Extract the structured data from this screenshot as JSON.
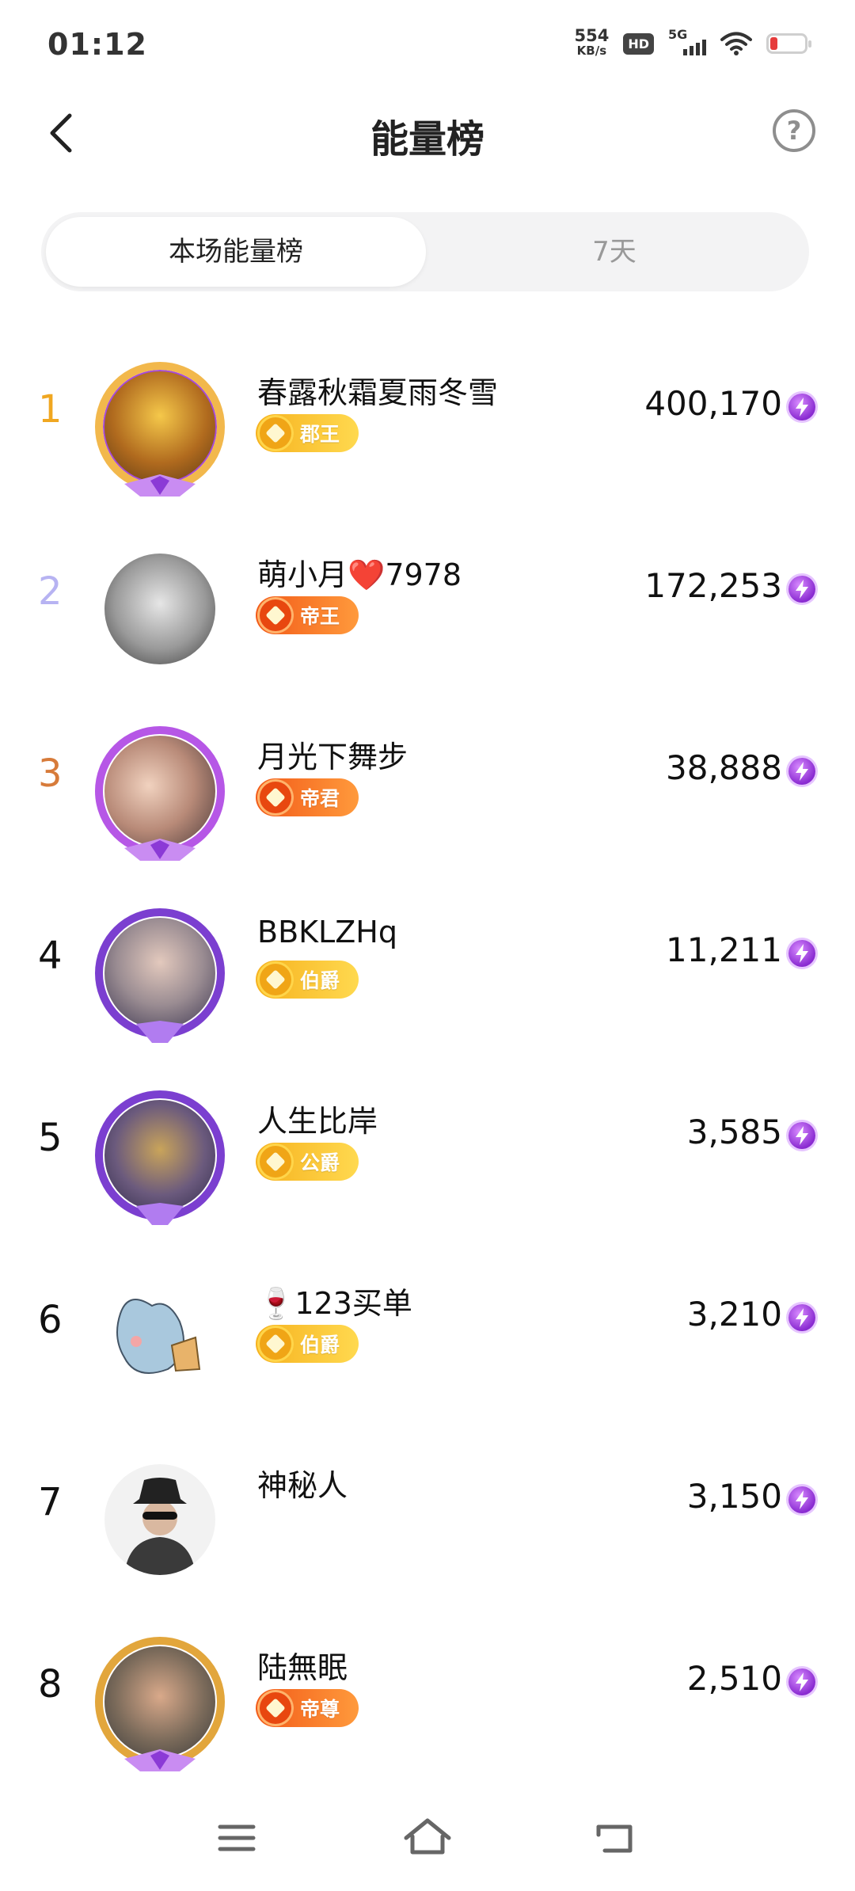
{
  "status": {
    "time": "01:12",
    "net_speed_value": "554",
    "net_speed_unit": "KB/s",
    "hd": "HD",
    "network": "5G"
  },
  "header": {
    "title": "能量榜",
    "help_icon": "?"
  },
  "tabs": [
    {
      "label": "本场能量榜",
      "active": true
    },
    {
      "label": "7天",
      "active": false
    }
  ],
  "rank_colors": {
    "1": "#f0a721",
    "2": "#b7b3f2",
    "3": "#d77b3a",
    "default": "#111111"
  },
  "ranking": [
    {
      "rank": "1",
      "name": "春露秋霜夏雨冬雪",
      "badge": "郡王",
      "badge_style": "gold",
      "score": "400,170"
    },
    {
      "rank": "2",
      "name": "萌小月❤️7978",
      "badge": "帝王",
      "badge_style": "orange",
      "score": "172,253"
    },
    {
      "rank": "3",
      "name": "月光下舞步",
      "badge": "帝君",
      "badge_style": "orange",
      "score": "38,888"
    },
    {
      "rank": "4",
      "name": "BBKLZHq",
      "badge": "伯爵",
      "badge_style": "gold",
      "score": "11,211"
    },
    {
      "rank": "5",
      "name": "人生比岸",
      "badge": "公爵",
      "badge_style": "gold",
      "score": "3,585"
    },
    {
      "rank": "6",
      "name": "🍷123买单",
      "badge": "伯爵",
      "badge_style": "gold",
      "score": "3,210"
    },
    {
      "rank": "7",
      "name": "神秘人",
      "badge": "",
      "badge_style": "none",
      "score": "3,150"
    },
    {
      "rank": "8",
      "name": "陆無眠",
      "badge": "帝尊",
      "badge_style": "orange",
      "score": "2,510"
    }
  ]
}
